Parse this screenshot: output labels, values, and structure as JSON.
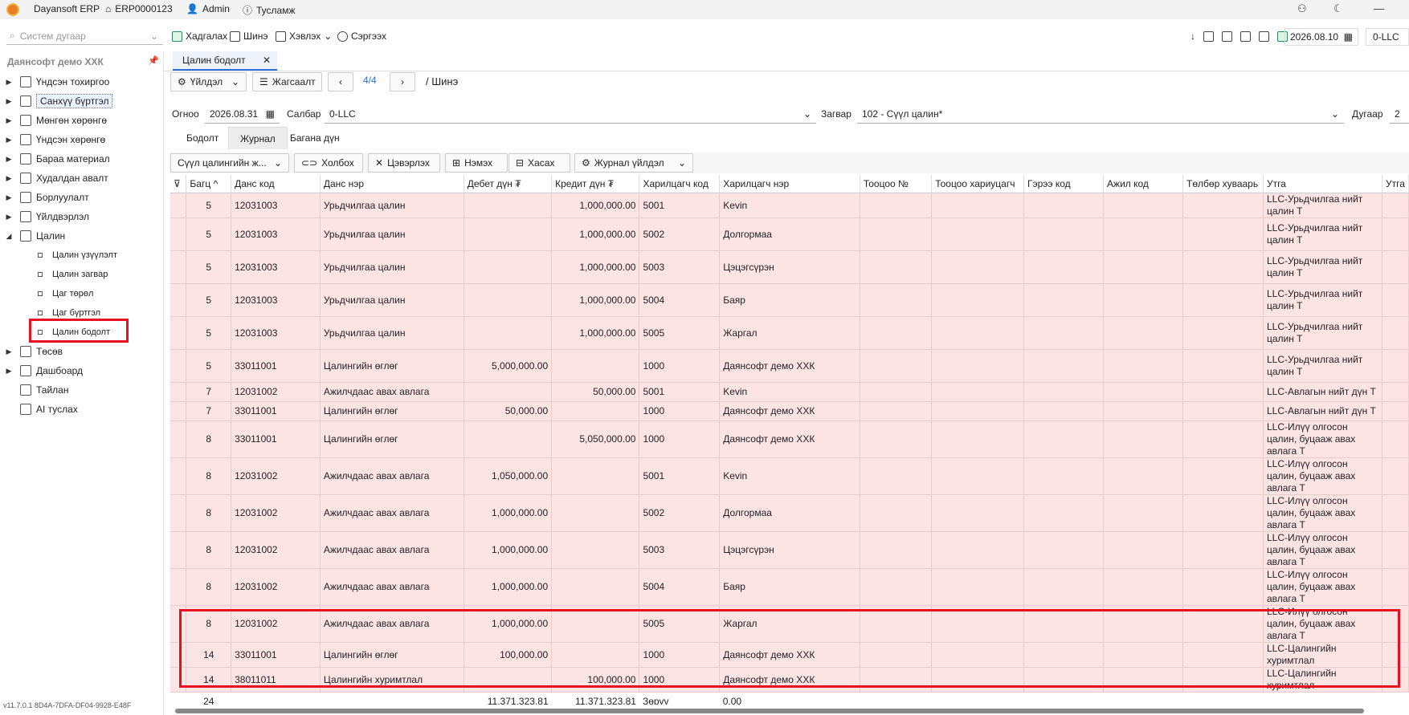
{
  "titlebar": {
    "app": "Dayansoft ERP",
    "code": "ERP0000123",
    "user": "Admin",
    "help": "Тусламж"
  },
  "toolbar": {
    "search_placeholder": "Систем дугаар",
    "save": "Хадгалах",
    "new": "Шинэ",
    "print": "Хэвлэх",
    "refresh": "Сэргээх",
    "date": "2026.08.10",
    "branch": "0-LLC"
  },
  "sidebar": {
    "company": "Даянсофт демо ХХК",
    "items": [
      {
        "label": "Үндсэн тохиргоо"
      },
      {
        "label": "Санхүү бүртгэл"
      },
      {
        "label": "Мөнгөн хөрөнгө"
      },
      {
        "label": "Үндсэн хөрөнгө"
      },
      {
        "label": "Бараа материал"
      },
      {
        "label": "Худалдан авалт"
      },
      {
        "label": "Борлуулалт"
      },
      {
        "label": "Үйлдвэрлэл"
      },
      {
        "label": "Цалин"
      }
    ],
    "subitems": [
      {
        "label": "Цалин үзүүлэлт"
      },
      {
        "label": "Цалин загвар"
      },
      {
        "label": "Цаг төрөл"
      },
      {
        "label": "Цаг бүртгэл"
      },
      {
        "label": "Цалин бодолт"
      }
    ],
    "items2": [
      {
        "label": "Төсөв"
      },
      {
        "label": "Дашбоард"
      },
      {
        "label": "Тайлан"
      },
      {
        "label": "AI туслах"
      }
    ],
    "version": "v11.7.0.1  8D4A-7DFA-DF04-9928-E48F"
  },
  "tab": {
    "title": "Цалин бодолт"
  },
  "actions": {
    "actions_label": "Үйлдэл",
    "list_label": "Жагсаалт",
    "pager": "4/4",
    "mode": "/ Шинэ"
  },
  "form": {
    "date_label": "Огноо",
    "date": "2026.08.31",
    "branch_label": "Салбар",
    "branch": "0-LLC",
    "template_label": "Загвар",
    "template": "102 - Сүүл цалин*",
    "number_label": "Дугаар",
    "number": "2"
  },
  "inner_tabs": [
    "Бодолт",
    "Журнал",
    "Багана дүн"
  ],
  "gridbar": {
    "select": "Сүүл цалингийн ж...",
    "link": "Холбох",
    "clear": "Цэвэрлэх",
    "add": "Нэмэх",
    "remove": "Хасах",
    "journal_action": "Журнал үйлдэл"
  },
  "grid": {
    "columns": [
      "Багц",
      "Данс код",
      "Данс нэр",
      "Дебет дүн ₮",
      "Кредит дүн ₮",
      "Харилцагч код",
      "Харилцагч нэр",
      "Тооцоо №",
      "Тооцоо хариуцагч",
      "Гэрээ код",
      "Ажил код",
      "Төлбөр хуваарь",
      "Утга",
      "Утга"
    ],
    "rows": [
      [
        "5",
        "12031003",
        "Урьдчилгаа цалин",
        "",
        "1,000,000.00",
        "5001",
        "Kevin",
        "",
        "",
        "",
        "",
        "",
        "LLC-Урьдчилгаа нийт цалин Т"
      ],
      [
        "5",
        "12031003",
        "Урьдчилгаа цалин",
        "",
        "1,000,000.00",
        "5002",
        "Долгормаа",
        "",
        "",
        "",
        "",
        "",
        "LLC-Урьдчилгаа нийт цалин Т"
      ],
      [
        "5",
        "12031003",
        "Урьдчилгаа цалин",
        "",
        "1,000,000.00",
        "5003",
        "Цэцэгсүрэн",
        "",
        "",
        "",
        "",
        "",
        "LLC-Урьдчилгаа нийт цалин Т"
      ],
      [
        "5",
        "12031003",
        "Урьдчилгаа цалин",
        "",
        "1,000,000.00",
        "5004",
        "Баяр",
        "",
        "",
        "",
        "",
        "",
        "LLC-Урьдчилгаа нийт цалин Т"
      ],
      [
        "5",
        "12031003",
        "Урьдчилгаа цалин",
        "",
        "1,000,000.00",
        "5005",
        "Жаргал",
        "",
        "",
        "",
        "",
        "",
        "LLC-Урьдчилгаа нийт цалин Т"
      ],
      [
        "5",
        "33011001",
        "Цалингийн өглөг",
        "5,000,000.00",
        "",
        "1000",
        "Даянсофт демо ХХК",
        "",
        "",
        "",
        "",
        "",
        "LLC-Урьдчилгаа нийт цалин Т"
      ],
      [
        "7",
        "12031002",
        "Ажилчдаас авах авлага",
        "",
        "50,000.00",
        "5001",
        "Kevin",
        "",
        "",
        "",
        "",
        "",
        "LLC-Авлагын нийт дүн Т"
      ],
      [
        "7",
        "33011001",
        "Цалингийн өглөг",
        "50,000.00",
        "",
        "1000",
        "Даянсофт демо ХХК",
        "",
        "",
        "",
        "",
        "",
        "LLC-Авлагын нийт дүн Т"
      ],
      [
        "8",
        "33011001",
        "Цалингийн өглөг",
        "",
        "5,050,000.00",
        "1000",
        "Даянсофт демо ХХК",
        "",
        "",
        "",
        "",
        "",
        "LLC-Илүү олгосон цалин, буцааж авах авлага Т"
      ],
      [
        "8",
        "12031002",
        "Ажилчдаас авах авлага",
        "1,050,000.00",
        "",
        "5001",
        "Kevin",
        "",
        "",
        "",
        "",
        "",
        "LLC-Илүү олгосон цалин, буцааж авах авлага Т"
      ],
      [
        "8",
        "12031002",
        "Ажилчдаас авах авлага",
        "1,000,000.00",
        "",
        "5002",
        "Долгормаа",
        "",
        "",
        "",
        "",
        "",
        "LLC-Илүү олгосон цалин, буцааж авах авлага Т"
      ],
      [
        "8",
        "12031002",
        "Ажилчдаас авах авлага",
        "1,000,000.00",
        "",
        "5003",
        "Цэцэгсүрэн",
        "",
        "",
        "",
        "",
        "",
        "LLC-Илүү олгосон цалин, буцааж авах авлага Т"
      ],
      [
        "8",
        "12031002",
        "Ажилчдаас авах авлага",
        "1,000,000.00",
        "",
        "5004",
        "Баяр",
        "",
        "",
        "",
        "",
        "",
        "LLC-Илүү олгосон цалин, буцааж авах авлага Т"
      ],
      [
        "8",
        "12031002",
        "Ажилчдаас авах авлага",
        "1,000,000.00",
        "",
        "5005",
        "Жаргал",
        "",
        "",
        "",
        "",
        "",
        "LLC-Илүү олгосон цалин, буцааж авах авлага Т"
      ],
      [
        "14",
        "33011001",
        "Цалингийн өглөг",
        "100,000.00",
        "",
        "1000",
        "Даянсофт демо ХХК",
        "",
        "",
        "",
        "",
        "",
        "LLC-Цалингийн хуримтлал"
      ],
      [
        "14",
        "38011011",
        "Цалингийн хуримтлал",
        "",
        "100,000.00",
        "1000",
        "Даянсофт демо ХХК",
        "",
        "",
        "",
        "",
        "",
        "LLC-Цалингийн хуримтлал"
      ]
    ],
    "footer": {
      "count": "24",
      "debit": "11,371,323.81",
      "credit": "11,371,323.81",
      "diff_label": "Зөрүү",
      "diff": "0.00"
    }
  }
}
